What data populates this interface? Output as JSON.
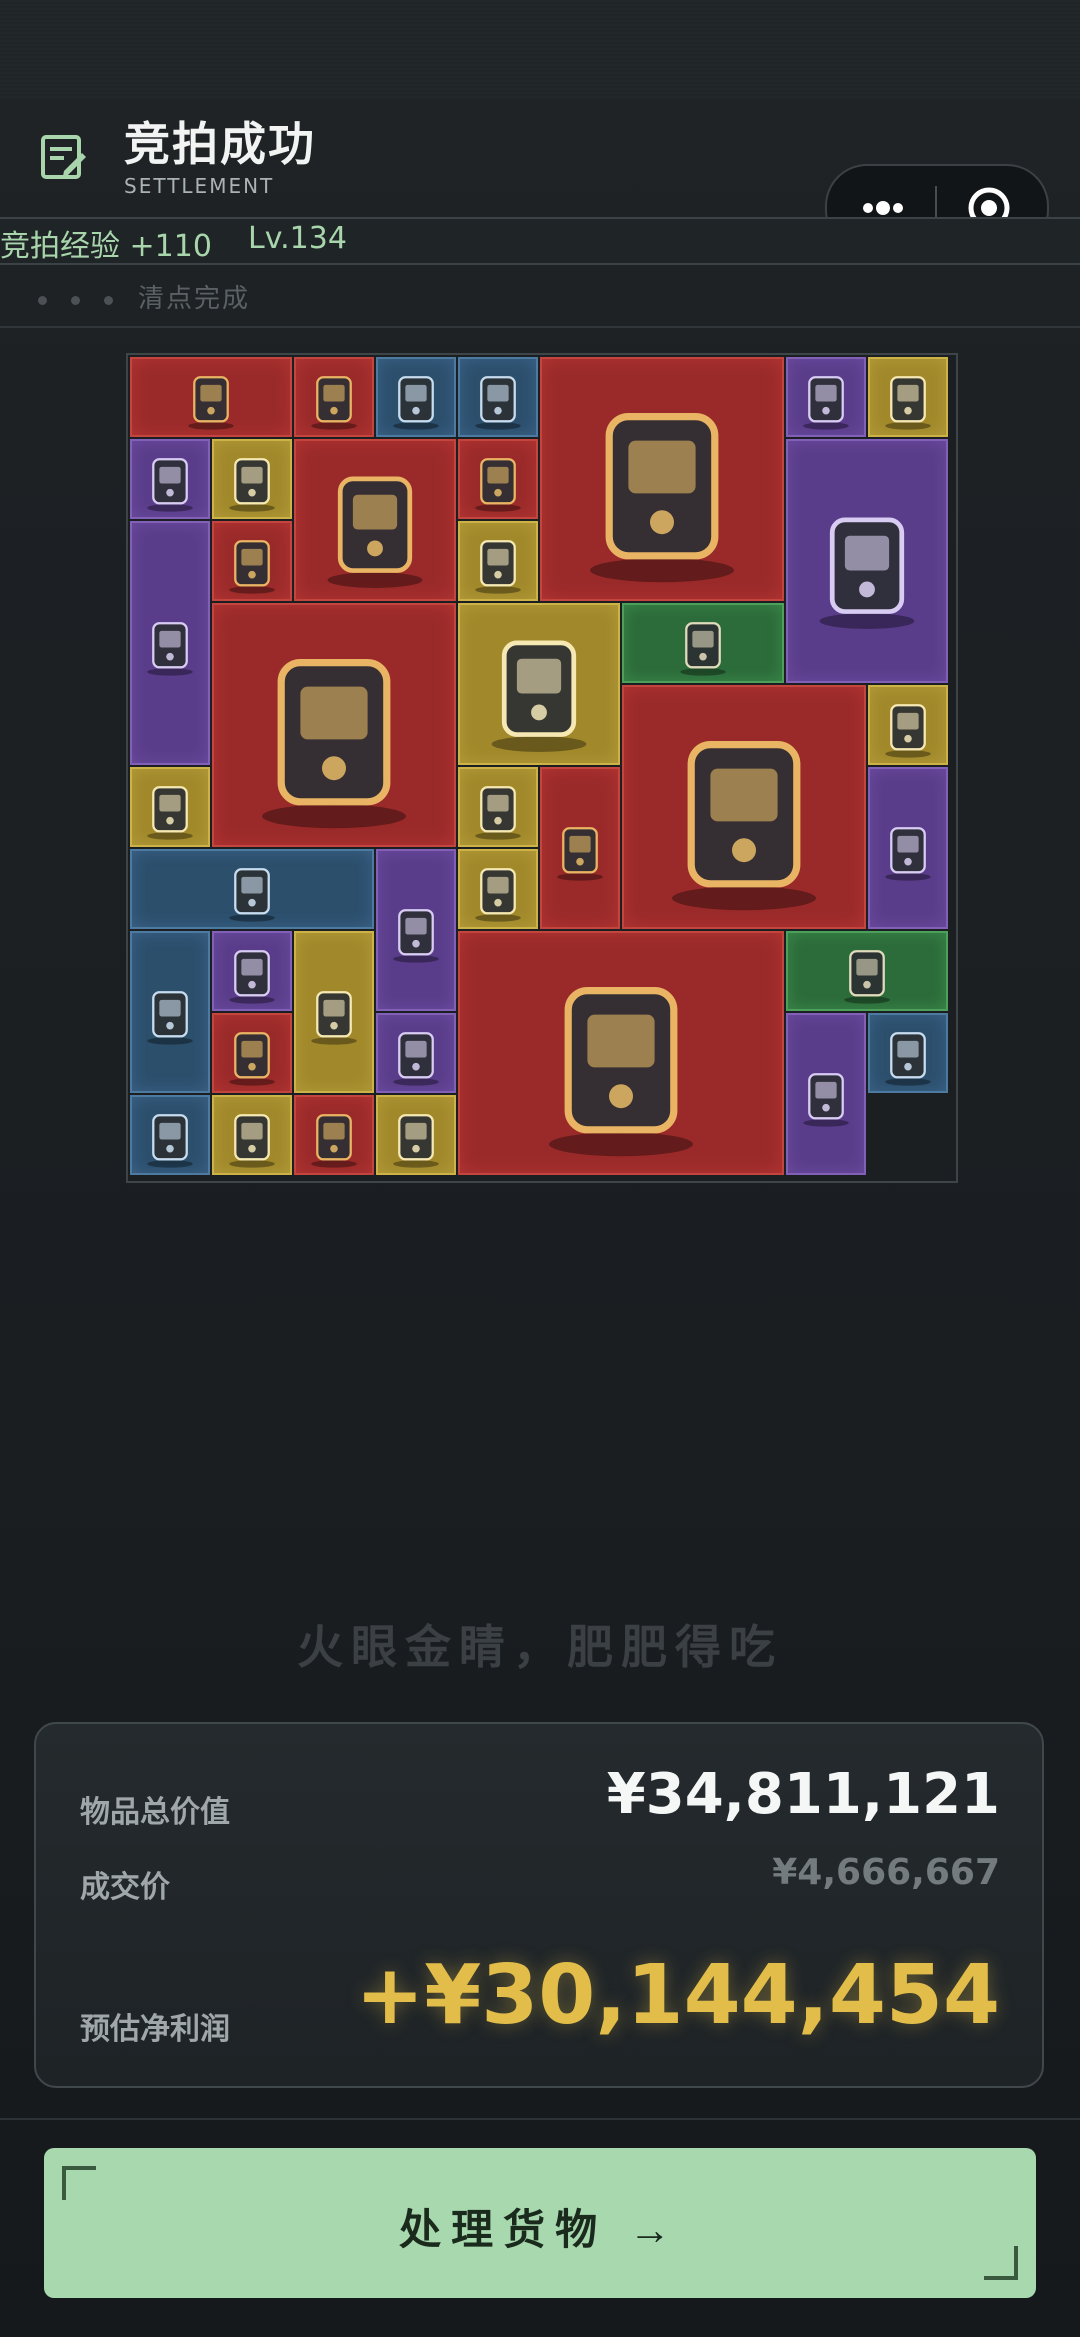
{
  "header": {
    "title": "竞拍成功",
    "subtitle": "SETTLEMENT",
    "icon": "edit-note-icon",
    "capsule_icons": [
      "more-dots-icon",
      "close-target-icon"
    ]
  },
  "progress": {
    "xp_text": "竞拍经验 +110",
    "level_text": "Lv.134",
    "status_text": "清点完成"
  },
  "loot_grid": {
    "rarity_colors": {
      "red": "#9a2a2a",
      "purple": "#5a3d8a",
      "gold": "#a1892b",
      "blue": "#2c4f6c",
      "green": "#2c6b3a"
    },
    "items": [
      {
        "name": "tablet-icon",
        "rarity": "red"
      },
      {
        "name": "usb-drive-icon",
        "rarity": "red"
      },
      {
        "name": "soda-can-icon",
        "rarity": "blue"
      },
      {
        "name": "tin-box-icon",
        "rarity": "blue"
      },
      {
        "name": "energy-reactor-icon",
        "rarity": "red"
      },
      {
        "name": "blade-icon",
        "rarity": "purple"
      },
      {
        "name": "gas-filter-icon",
        "rarity": "gold"
      },
      {
        "name": "vest-icon",
        "rarity": "purple"
      },
      {
        "name": "cheese-bar-icon",
        "rarity": "gold"
      },
      {
        "name": "radio-icon",
        "rarity": "red"
      },
      {
        "name": "flashlight-icon",
        "rarity": "red"
      },
      {
        "name": "moon-lamp-icon",
        "rarity": "purple"
      },
      {
        "name": "filter-canister-icon",
        "rarity": "gold"
      },
      {
        "name": "lantern-icon",
        "rarity": "purple"
      },
      {
        "name": "diamond-icon",
        "rarity": "red"
      },
      {
        "name": "crown-box-icon",
        "rarity": "red"
      },
      {
        "name": "camera-icon",
        "rarity": "gold"
      },
      {
        "name": "old-paper-icon",
        "rarity": "green"
      },
      {
        "name": "energy-reactor-icon",
        "rarity": "red"
      },
      {
        "name": "pocket-watch-icon",
        "rarity": "gold"
      },
      {
        "name": "ration-box-icon",
        "rarity": "gold"
      },
      {
        "name": "lens-icon",
        "rarity": "gold"
      },
      {
        "name": "champagne-icon",
        "rarity": "red"
      },
      {
        "name": "envelope-icon",
        "rarity": "purple"
      },
      {
        "name": "saw-icon",
        "rarity": "blue"
      },
      {
        "name": "book-icon",
        "rarity": "purple"
      },
      {
        "name": "pearls-icon",
        "rarity": "gold"
      },
      {
        "name": "ballerina-icon",
        "rarity": "blue"
      },
      {
        "name": "arrowhead-icon",
        "rarity": "purple"
      },
      {
        "name": "figurine-icon",
        "rarity": "gold"
      },
      {
        "name": "server-crate-icon",
        "rarity": "red"
      },
      {
        "name": "map-icon",
        "rarity": "green"
      },
      {
        "name": "compass-icon",
        "rarity": "red"
      },
      {
        "name": "torch-icon",
        "rarity": "purple"
      },
      {
        "name": "spearhead-icon",
        "rarity": "purple"
      },
      {
        "name": "coffee-bag-icon",
        "rarity": "blue"
      },
      {
        "name": "ammo-box-icon",
        "rarity": "blue"
      },
      {
        "name": "compact-camera-icon",
        "rarity": "gold"
      },
      {
        "name": "watch-chain-icon",
        "rarity": "red"
      },
      {
        "name": "pendant-icon",
        "rarity": "gold"
      }
    ]
  },
  "slogan": "火眼金睛，肥肥得吃",
  "summary": {
    "total_label": "物品总价值",
    "total_value": "¥34,811,121",
    "deal_label": "成交价",
    "deal_value": "¥4,666,667",
    "profit_label": "预估净利润",
    "profit_value": "+¥30,144,454"
  },
  "action": {
    "button_label": "处理货物 →"
  }
}
